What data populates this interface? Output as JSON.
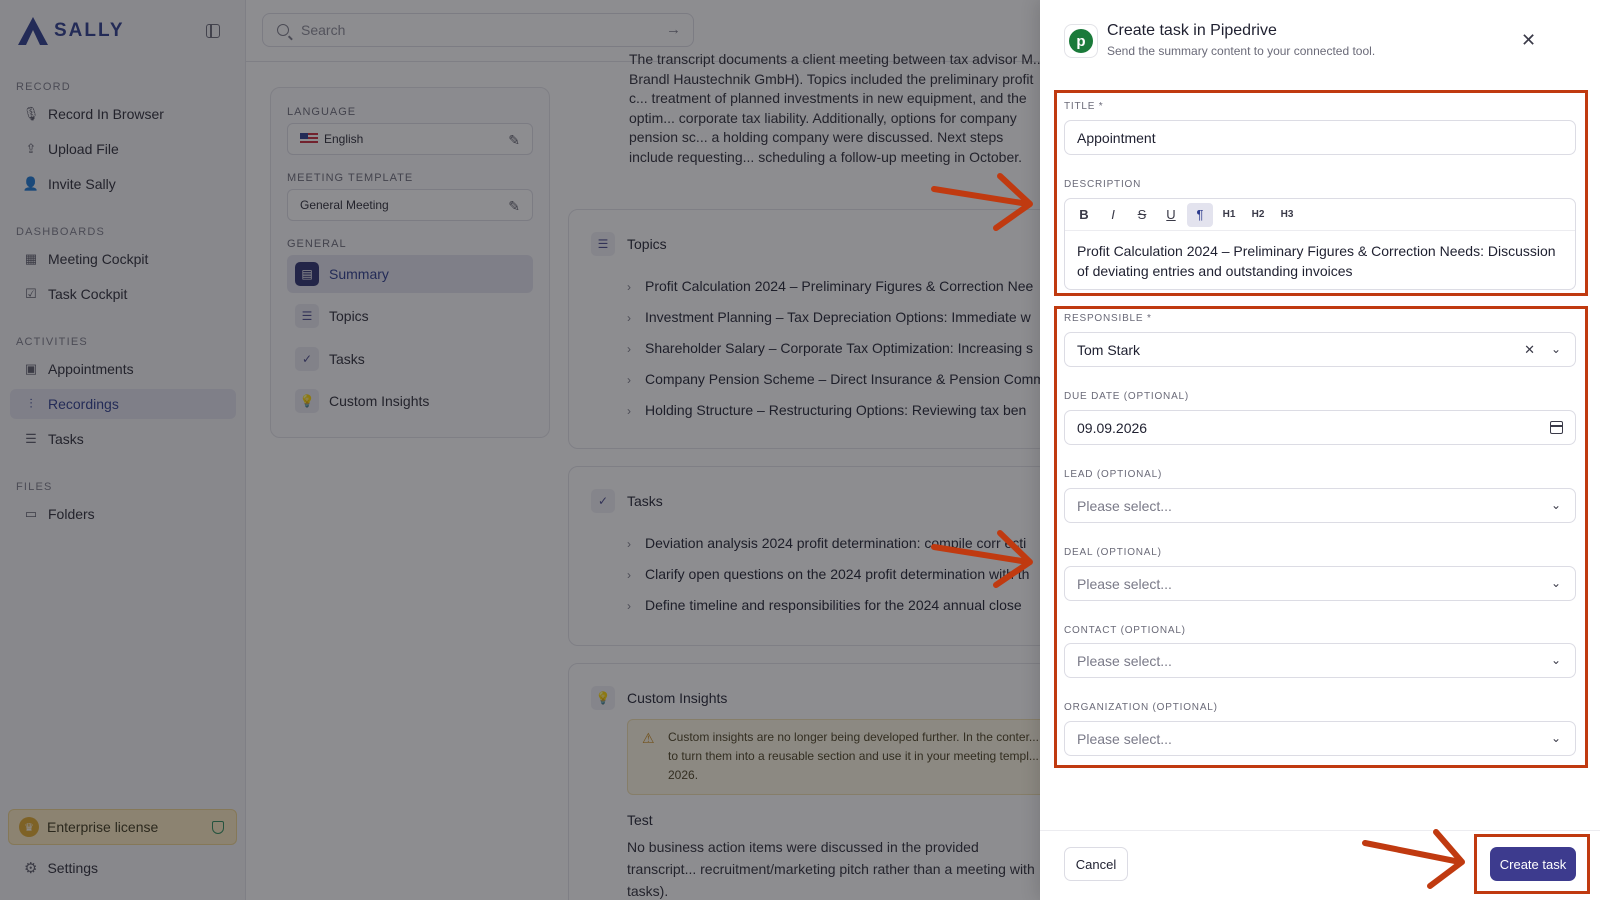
{
  "app": {
    "logo_text": "SALLY"
  },
  "sidebar": {
    "sections": [
      {
        "title": "RECORD",
        "items": [
          {
            "label": "Record In Browser",
            "icon": "microphone-icon"
          },
          {
            "label": "Upload File",
            "icon": "upload-icon"
          },
          {
            "label": "Invite Sally",
            "icon": "add-user-icon"
          }
        ]
      },
      {
        "title": "DASHBOARDS",
        "items": [
          {
            "label": "Meeting Cockpit",
            "icon": "grid-icon"
          },
          {
            "label": "Task Cockpit",
            "icon": "checkbox-icon"
          }
        ]
      },
      {
        "title": "ACTIVITIES",
        "items": [
          {
            "label": "Appointments",
            "icon": "calendar-icon"
          },
          {
            "label": "Recordings",
            "icon": "waveform-icon",
            "active": true
          },
          {
            "label": "Tasks",
            "icon": "list-check-icon"
          }
        ]
      },
      {
        "title": "FILES",
        "items": [
          {
            "label": "Folders",
            "icon": "folder-icon"
          }
        ]
      }
    ],
    "license_label": "Enterprise license",
    "settings_label": "Settings"
  },
  "search": {
    "placeholder": "Search"
  },
  "left_panel": {
    "language_label": "LANGUAGE",
    "language_value": "English",
    "template_label": "MEETING TEMPLATE",
    "template_value": "General Meeting",
    "general_label": "GENERAL",
    "items": [
      "Summary",
      "Topics",
      "Tasks",
      "Custom Insights"
    ]
  },
  "summary": {
    "text": "The transcript documents a client meeting between tax advisor M... Brandl Haustechnik GmbH). Topics included the preliminary profit c... treatment of planned investments in new equipment, and the optim... corporate tax liability. Additionally, options for company pension sc... a holding company were discussed. Next steps include requesting... scheduling a follow-up meeting in October."
  },
  "topics": {
    "title": "Topics",
    "rows": [
      "Profit Calculation 2024 – Preliminary Figures & Correction Nee",
      "Investment Planning – Tax Depreciation Options: Immediate w",
      "Shareholder Salary – Corporate Tax Optimization: Increasing s",
      "Company Pension Scheme – Direct Insurance & Pension Comm",
      "Holding Structure – Restructuring Options: Reviewing tax ben"
    ]
  },
  "tasks": {
    "title": "Tasks",
    "rows": [
      "Deviation analysis 2024 profit determination: compile corr ecti",
      "Clarify open questions on the 2024 profit determination with th",
      "Define timeline and responsibilities for the 2024 annual close"
    ]
  },
  "insights": {
    "title": "Custom Insights",
    "warning": "Custom insights are no longer being developed further. In the conter... to turn them into a reusable section and use it in your meeting templ... 2026.",
    "test_title": "Test",
    "test_body": "No business action items were discussed in the provided transcript... recruitment/marketing pitch rather than a meeting with tasks)."
  },
  "modal": {
    "title": "Create task in Pipedrive",
    "subtitle": "Send the summary content to your connected tool.",
    "title_label": "TITLE *",
    "title_value": "Appointment",
    "description_label": "DESCRIPTION",
    "toolbar": [
      "B",
      "I",
      "S",
      "U",
      "¶",
      "H1",
      "H2",
      "H3"
    ],
    "description_value": "Profit Calculation 2024 – Preliminary Figures & Correction Needs: Discussion of deviating entries and outstanding invoices",
    "responsible_label": "RESPONSIBLE *",
    "responsible_value": "Tom Stark",
    "due_label": "DUE DATE (OPTIONAL)",
    "due_value": "09.09.2026",
    "lead_label": "LEAD (OPTIONAL)",
    "deal_label": "DEAL (OPTIONAL)",
    "contact_label": "CONTACT (OPTIONAL)",
    "organization_label": "ORGANIZATION (OPTIONAL)",
    "select_placeholder": "Please select...",
    "cancel_label": "Cancel",
    "create_label": "Create task"
  },
  "colors": {
    "accent": "#3d3b8e",
    "annotation": "#c03a10",
    "pipedrive": "#1a7a3a"
  }
}
